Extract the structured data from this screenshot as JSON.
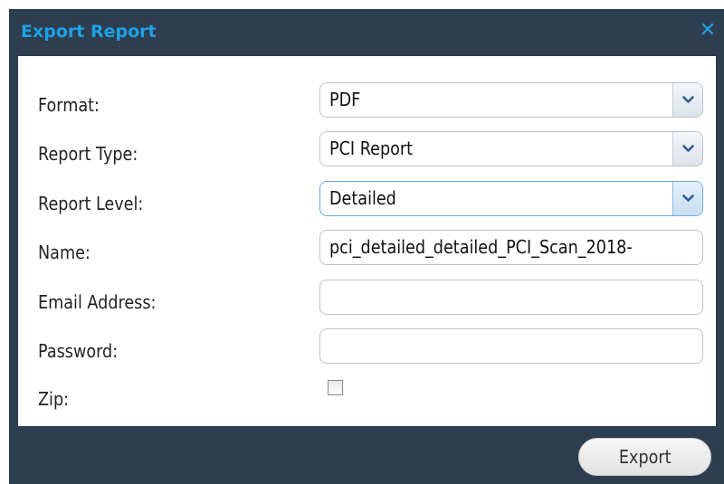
{
  "dialog": {
    "title": "Export Report",
    "close_symbol": "✕",
    "close_icon": "close-icon"
  },
  "form": {
    "format": {
      "label": "Format:",
      "value": "PDF"
    },
    "report_type": {
      "label": "Report Type:",
      "value": "PCI Report"
    },
    "report_level": {
      "label": "Report Level:",
      "value": "Detailed"
    },
    "name": {
      "label": "Name:",
      "value": "pci_detailed_detailed_PCI_Scan_2018-"
    },
    "email": {
      "label": "Email Address:",
      "value": ""
    },
    "password": {
      "label": "Password:",
      "value": ""
    },
    "zip": {
      "label": "Zip:",
      "checked": false
    }
  },
  "footer": {
    "export_label": "Export"
  },
  "colors": {
    "header_bg": "#2c3e50",
    "title_accent": "#1ea1e6",
    "panel_bg": "#ffffff",
    "field_border": "#bcc3cc",
    "focus_border": "#6aa9e0"
  }
}
